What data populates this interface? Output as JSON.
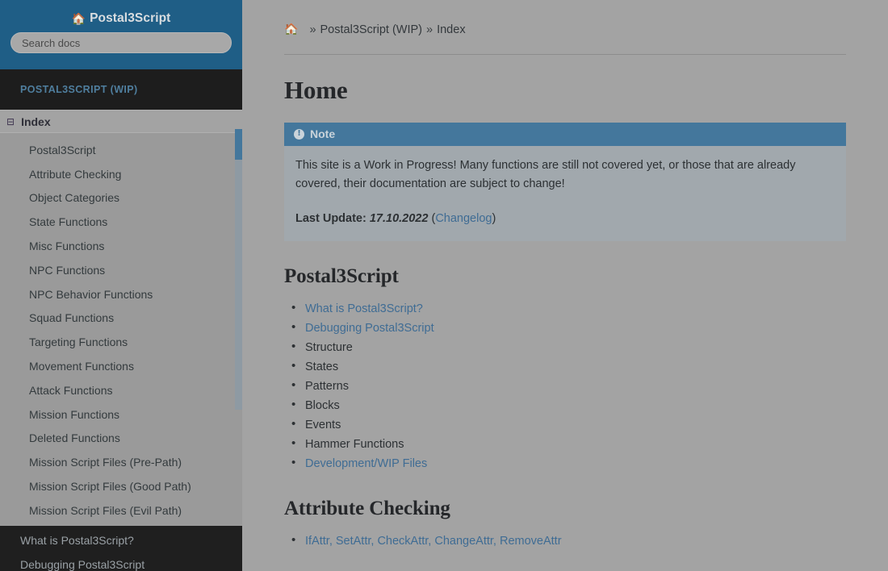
{
  "sidebar": {
    "brand": {
      "title": "Postal3Script",
      "home_icon": "home-icon"
    },
    "search": {
      "placeholder": "Search docs",
      "value": ""
    },
    "caption": "POSTAL3SCRIPT (WIP)",
    "current_section": {
      "expand_icon": "minus-square-icon",
      "label": "Index"
    },
    "items": [
      {
        "label": "Postal3Script"
      },
      {
        "label": "Attribute Checking"
      },
      {
        "label": "Object Categories"
      },
      {
        "label": "State Functions"
      },
      {
        "label": "Misc Functions"
      },
      {
        "label": "NPC Functions"
      },
      {
        "label": "NPC Behavior Functions"
      },
      {
        "label": "Squad Functions"
      },
      {
        "label": "Targeting Functions"
      },
      {
        "label": "Movement Functions"
      },
      {
        "label": "Attack Functions"
      },
      {
        "label": "Mission Functions"
      },
      {
        "label": "Deleted Functions"
      },
      {
        "label": "Mission Script Files (Pre-Path)"
      },
      {
        "label": "Mission Script Files (Good Path)"
      },
      {
        "label": "Mission Script Files (Evil Path)"
      }
    ],
    "dark_items": [
      {
        "label": "What is Postal3Script?"
      },
      {
        "label": "Debugging Postal3Script"
      }
    ]
  },
  "breadcrumb": {
    "home_icon": "home-icon",
    "separator": "»",
    "items": [
      {
        "label": "Postal3Script (WIP)"
      },
      {
        "label": "Index"
      }
    ]
  },
  "content": {
    "title": "Home",
    "note": {
      "icon": "exclamation-circle-icon",
      "title": "Note",
      "paragraph": "This site is a Work in Progress! Many functions are still not covered yet, or those that are already covered, their documentation are subject to change!",
      "update_label": "Last Update:",
      "update_date": "17.10.2022",
      "changelog_open": "(",
      "changelog_link": "Changelog",
      "changelog_close": ")"
    },
    "sections": [
      {
        "heading": "Postal3Script",
        "items": [
          {
            "label": "What is Postal3Script?",
            "link": true
          },
          {
            "label": "Debugging Postal3Script",
            "link": true
          },
          {
            "label": "Structure",
            "link": false
          },
          {
            "label": "States",
            "link": false
          },
          {
            "label": "Patterns",
            "link": false
          },
          {
            "label": "Blocks",
            "link": false
          },
          {
            "label": "Events",
            "link": false
          },
          {
            "label": "Hammer Functions",
            "link": false
          },
          {
            "label": "Development/WIP Files",
            "link": true
          }
        ]
      },
      {
        "heading": "Attribute Checking",
        "items": [
          {
            "label": "IfAttr, SetAttr, CheckAttr, ChangeAttr, RemoveAttr",
            "link": true
          }
        ]
      }
    ]
  },
  "colors": {
    "sidebar_header_bg": "#1f5e86",
    "sidebar_dark_bg": "#1f1f1f",
    "page_bg": "#a3a3a3",
    "note_header_bg": "#44779c",
    "note_body_bg": "#a1a8ad",
    "link": "#3f6c94",
    "caption": "#4f7e9e"
  }
}
